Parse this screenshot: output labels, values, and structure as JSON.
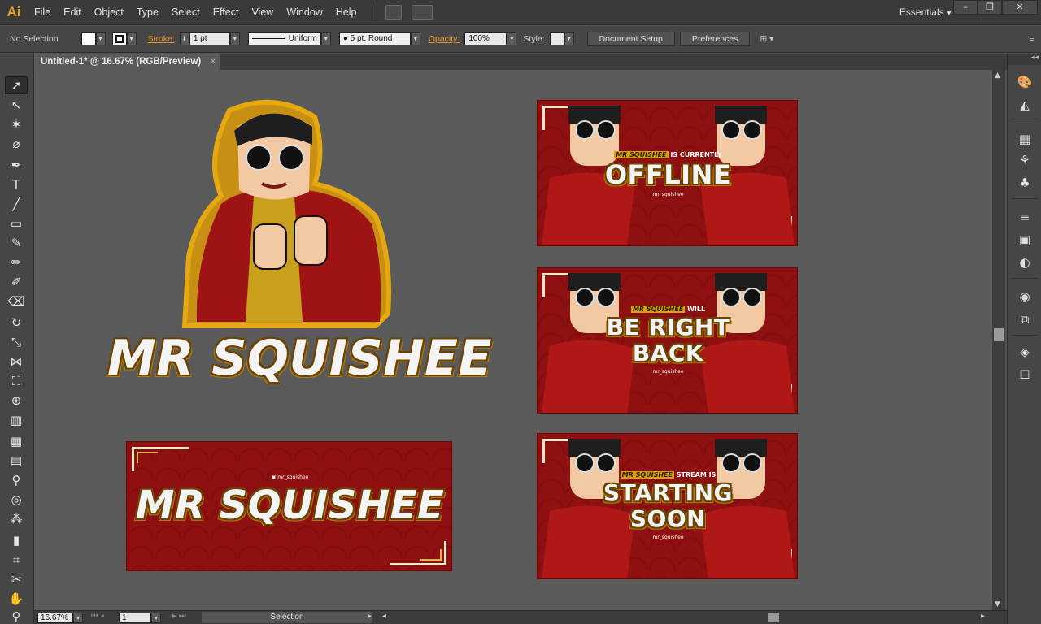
{
  "app": {
    "logo": "Ai"
  },
  "menus": [
    "File",
    "Edit",
    "Object",
    "Type",
    "Select",
    "Effect",
    "View",
    "Window",
    "Help"
  ],
  "workspace": {
    "label": "Essentials",
    "caret": "▾"
  },
  "window_controls": {
    "minimize": "–",
    "restore": "❐",
    "close": "✕"
  },
  "control_bar": {
    "selection": "No Selection",
    "stroke_label": "Stroke:",
    "stroke_weight": "1 pt",
    "profile": "Uniform",
    "brush": "5 pt. Round",
    "opacity_label": "Opacity:",
    "opacity_value": "100%",
    "style_label": "Style:",
    "document_setup": "Document Setup",
    "preferences": "Preferences"
  },
  "document_tab": {
    "title": "Untitled-1* @ 16.67% (RGB/Preview)",
    "close": "×"
  },
  "status_bar": {
    "zoom": "16.67%",
    "artboard": "1",
    "tool": "Selection"
  },
  "artwork": {
    "logo_text": "MR SQUISHEE",
    "banner_main": {
      "title": "MR SQUISHEE",
      "handle": "mr_squishee"
    },
    "panel_offline": {
      "name": "MR SQUISHEE",
      "line": "IS CURRENTLY",
      "big": "OFFLINE",
      "handle": "mr_squishee"
    },
    "panel_brb": {
      "name": "MR SQUISHEE",
      "line": "WILL",
      "big1": "BE RIGHT",
      "big2": "BACK",
      "handle": "mr_squishee"
    },
    "panel_soon": {
      "name": "MR SQUISHEE",
      "line": "STREAM IS",
      "big1": "STARTING",
      "big2": "SOON",
      "handle": "mr_squishee"
    }
  },
  "colors": {
    "accent": "#e8962a",
    "banner_red": "#8e1010",
    "gold": "#d6a10e",
    "canvas": "#5a5a5a"
  }
}
